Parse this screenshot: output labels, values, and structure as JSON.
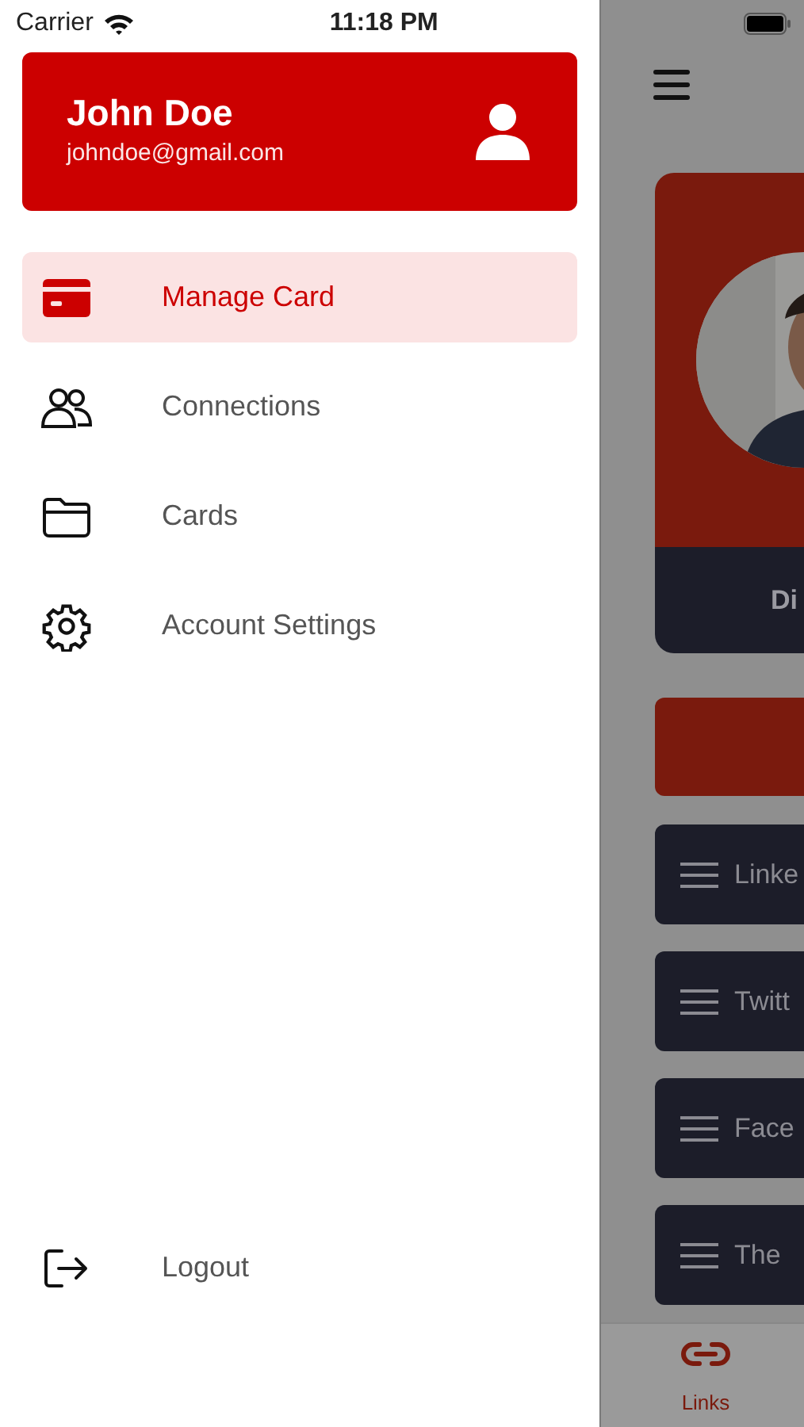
{
  "status_bar": {
    "carrier": "Carrier",
    "time": "11:18 PM"
  },
  "drawer": {
    "profile": {
      "name": "John Doe",
      "email": "johndoe@gmail.com"
    },
    "items": [
      {
        "label": "Manage Card",
        "kind": "card",
        "selected": true
      },
      {
        "label": "Connections",
        "kind": "people",
        "selected": false
      },
      {
        "label": "Cards",
        "kind": "folder",
        "selected": false
      },
      {
        "label": "Account Settings",
        "kind": "gear",
        "selected": false
      }
    ],
    "logout": {
      "label": "Logout"
    }
  },
  "background": {
    "card": {
      "name": "Di"
    },
    "links": [
      {
        "label": "Linke"
      },
      {
        "label": "Twitt"
      },
      {
        "label": "Face"
      },
      {
        "label": "The"
      }
    ],
    "tab_bar": {
      "tabs": [
        {
          "label": "Links",
          "selected": true
        }
      ]
    }
  }
}
